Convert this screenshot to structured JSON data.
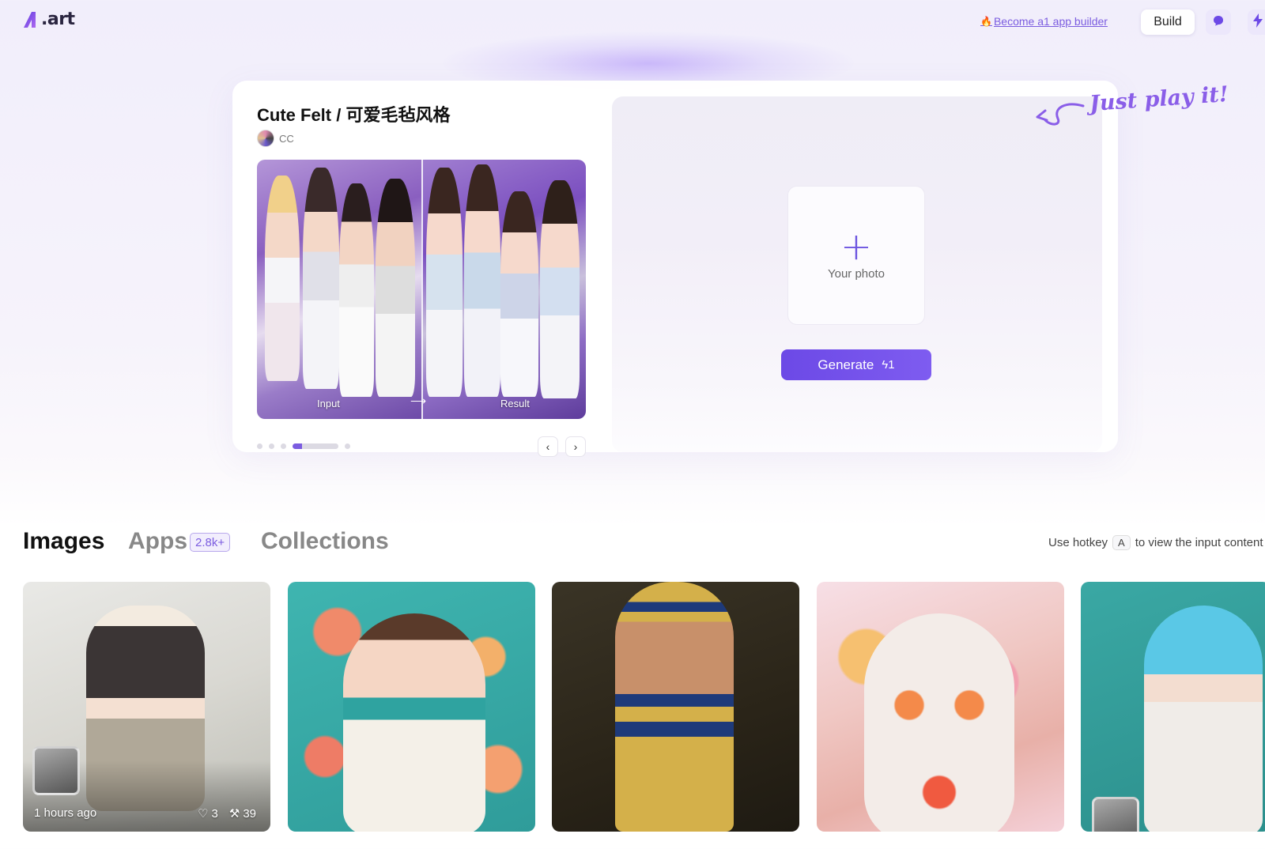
{
  "header": {
    "logo_text": ".art",
    "builder_link": "Become a1 app builder",
    "build_label": "Build"
  },
  "hero": {
    "title": "Cute Felt / 可爱毛毡风格",
    "author": "CC",
    "input_label": "Input",
    "result_label": "Result",
    "arrow": "⟶",
    "carousel_active_index": 3,
    "carousel_count": 5,
    "prev_icon": "‹",
    "next_icon": "›",
    "upload_label": "Your photo",
    "generate_label": "Generate",
    "generate_cost": "1",
    "play_hint": "Just play it!"
  },
  "tabs": {
    "images": "Images",
    "apps": "Apps",
    "apps_count": "2.8k+",
    "collections": "Collections"
  },
  "hotkey": {
    "prefix": "Use hotkey",
    "key": "A",
    "suffix": "to view the input content"
  },
  "gallery": [
    {
      "time": "1 hours ago",
      "likes": "3",
      "remixes": "39"
    },
    {},
    {},
    {},
    {}
  ],
  "colors": {
    "accent": "#6c49e6",
    "link": "#7b5ce0"
  }
}
